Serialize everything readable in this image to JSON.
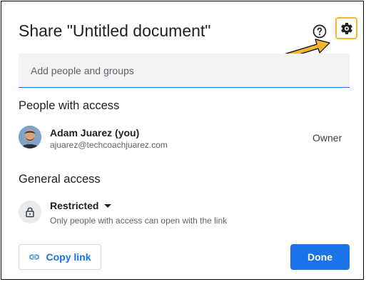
{
  "dialog": {
    "title": "Share \"Untitled document\""
  },
  "header_icons": {
    "help": "help-circle-icon",
    "settings": "gear-icon",
    "settings_highlight_color": "#f1b82d",
    "annotation_arrow_color": "#f1b82d"
  },
  "add_people": {
    "placeholder": "Add people and groups",
    "value": ""
  },
  "people_section": {
    "heading": "People with access",
    "people": [
      {
        "name": "Adam Juarez (you)",
        "email": "ajuarez@techcoachjuarez.com",
        "role": "Owner"
      }
    ]
  },
  "general_access": {
    "heading": "General access",
    "selected": "Restricted",
    "description": "Only people with access can open with the link",
    "icon": "lock-icon"
  },
  "footer": {
    "copy_link_label": "Copy link",
    "copy_link_icon": "link-icon",
    "done_label": "Done",
    "accent_color": "#1a73e8"
  }
}
